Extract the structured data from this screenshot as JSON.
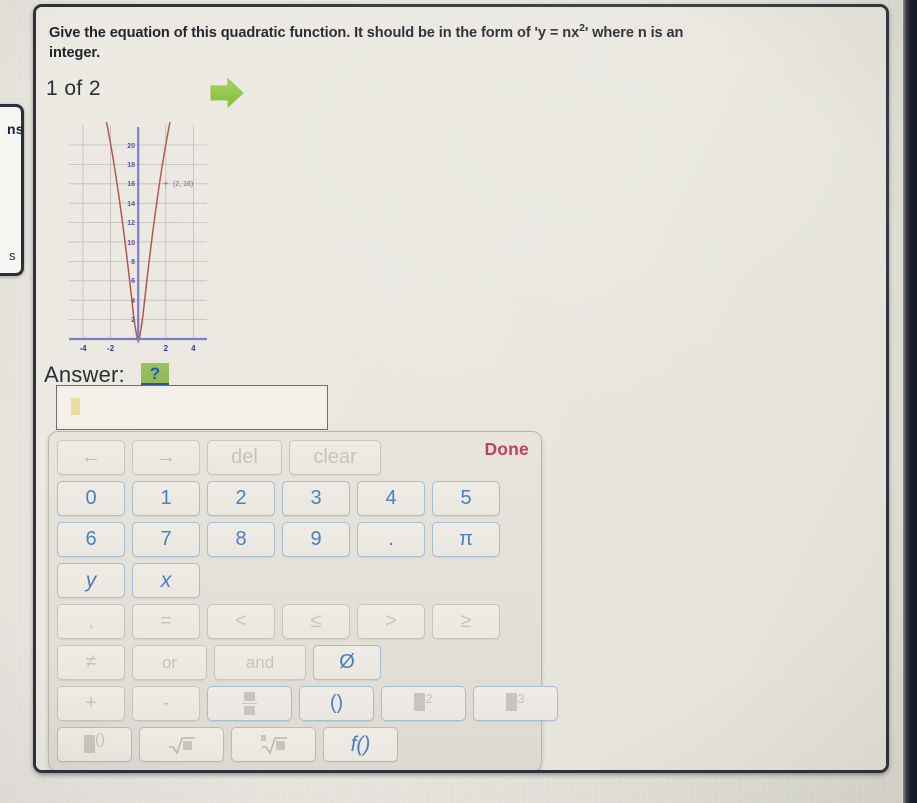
{
  "question": {
    "line1_a": "Give the equation of this quadratic function. It should be in the form of 'y = nx",
    "line1_sup": "2",
    "line1_b": "' where n is an",
    "line2": "integer."
  },
  "progress": {
    "label": "1 of 2"
  },
  "next_arrow": {
    "name": "next-arrow-icon",
    "color": "#8cc63f"
  },
  "left_panel": {
    "text_top": "ns",
    "text_bottom": "s"
  },
  "answer": {
    "label": "Answer:",
    "help_badge": "?",
    "input_value": "",
    "input_placeholder": ""
  },
  "keyboard": {
    "done_label": "Done",
    "rows": [
      [
        {
          "label": "←",
          "name": "key-left-arrow",
          "style": "gray",
          "width": "w68"
        },
        {
          "label": "→",
          "name": "key-right-arrow",
          "style": "gray",
          "width": "w68"
        },
        {
          "label": "del",
          "name": "key-del",
          "style": "dim",
          "width": "w75"
        },
        {
          "label": "clear",
          "name": "key-clear",
          "style": "dim",
          "width": "w92"
        }
      ],
      [
        {
          "label": "0",
          "name": "key-0",
          "width": "w68"
        },
        {
          "label": "1",
          "name": "key-1",
          "width": "w68"
        },
        {
          "label": "2",
          "name": "key-2",
          "width": "w68"
        },
        {
          "label": "3",
          "name": "key-3",
          "width": "w68"
        },
        {
          "label": "4",
          "name": "key-4",
          "width": "w68"
        },
        {
          "label": "5",
          "name": "key-5",
          "width": "w68"
        }
      ],
      [
        {
          "label": "6",
          "name": "key-6",
          "width": "w68"
        },
        {
          "label": "7",
          "name": "key-7",
          "width": "w68"
        },
        {
          "label": "8",
          "name": "key-8",
          "width": "w68"
        },
        {
          "label": "9",
          "name": "key-9",
          "width": "w68"
        },
        {
          "label": ".",
          "name": "key-decimal",
          "width": "w68"
        },
        {
          "label": "π",
          "name": "key-pi",
          "width": "w68"
        }
      ],
      [
        {
          "label": "y",
          "name": "key-y",
          "width": "w68",
          "italic": true
        },
        {
          "label": "x",
          "name": "key-x",
          "width": "w68",
          "italic": true
        }
      ],
      [
        {
          "label": ",",
          "name": "key-comma",
          "style": "dim",
          "width": "w68"
        },
        {
          "label": "=",
          "name": "key-equals",
          "style": "dim",
          "width": "w68"
        },
        {
          "label": "<",
          "name": "key-less-than",
          "style": "dim",
          "width": "w68"
        },
        {
          "label": "≤",
          "name": "key-less-equal",
          "style": "dim",
          "width": "w68"
        },
        {
          "label": ">",
          "name": "key-greater-than",
          "style": "dim",
          "width": "w68"
        },
        {
          "label": "≥",
          "name": "key-greater-equal",
          "style": "dim",
          "width": "w68"
        }
      ],
      [
        {
          "label": "≠",
          "name": "key-not-equal",
          "style": "dim",
          "width": "w68"
        },
        {
          "label": "or",
          "name": "key-or",
          "style": "dim",
          "width": "w75"
        },
        {
          "label": "and",
          "name": "key-and",
          "style": "dim",
          "width": "w92"
        },
        {
          "label": "Ø",
          "name": "key-empty-set",
          "width": "w68"
        }
      ],
      [
        {
          "label": "+",
          "name": "key-plus",
          "style": "dim",
          "width": "w68"
        },
        {
          "label": "-",
          "name": "key-minus",
          "style": "dim",
          "width": "w68"
        },
        {
          "label": "FRAC",
          "name": "key-fraction",
          "width": "w85",
          "glyph": "fraction"
        },
        {
          "label": "()",
          "name": "key-parentheses",
          "width": "w75"
        },
        {
          "label": "SQUARE",
          "name": "key-square-power",
          "width": "w85",
          "glyph": "power2"
        },
        {
          "label": "CUBE",
          "name": "key-cube-power",
          "width": "w85",
          "glyph": "power3"
        }
      ],
      [
        {
          "label": "POW",
          "name": "key-general-power",
          "width": "w75",
          "glyph": "powern"
        },
        {
          "label": "SQRT",
          "name": "key-square-root",
          "width": "w85",
          "glyph": "sqrt"
        },
        {
          "label": "NROOT",
          "name": "key-nth-root",
          "width": "w85",
          "glyph": "nroot"
        },
        {
          "label": "f()",
          "name": "key-function",
          "width": "w75",
          "italic": true
        }
      ]
    ]
  },
  "chart_data": {
    "type": "line",
    "title": "",
    "xlabel": "",
    "ylabel": "",
    "equation": "y = 4x²",
    "xlim": [
      -5,
      5
    ],
    "ylim": [
      0,
      21
    ],
    "x_ticks": [
      -4,
      -2,
      2,
      4
    ],
    "y_ticks": [
      2,
      4,
      6,
      8,
      10,
      12,
      14,
      16,
      18,
      20
    ],
    "grid": true,
    "curve_color": "#b5574d",
    "axis_color": "#7b7ec6",
    "grid_color": "#b9b9c4",
    "label_color": "#5b4fa8",
    "annotations": [
      {
        "label": "(2, 16)",
        "x": 2,
        "y": 16,
        "marker": "+",
        "color": "#b0569b"
      }
    ],
    "points": [
      {
        "x": -2.3,
        "y": 21.2
      },
      {
        "x": -2.0,
        "y": 16.0
      },
      {
        "x": -1.5,
        "y": 9.0
      },
      {
        "x": -1.0,
        "y": 4.0
      },
      {
        "x": -0.5,
        "y": 1.0
      },
      {
        "x": 0,
        "y": 0
      },
      {
        "x": 0.5,
        "y": 1.0
      },
      {
        "x": 1.0,
        "y": 4.0
      },
      {
        "x": 1.5,
        "y": 9.0
      },
      {
        "x": 2.0,
        "y": 16.0
      },
      {
        "x": 2.3,
        "y": 21.2
      }
    ]
  }
}
